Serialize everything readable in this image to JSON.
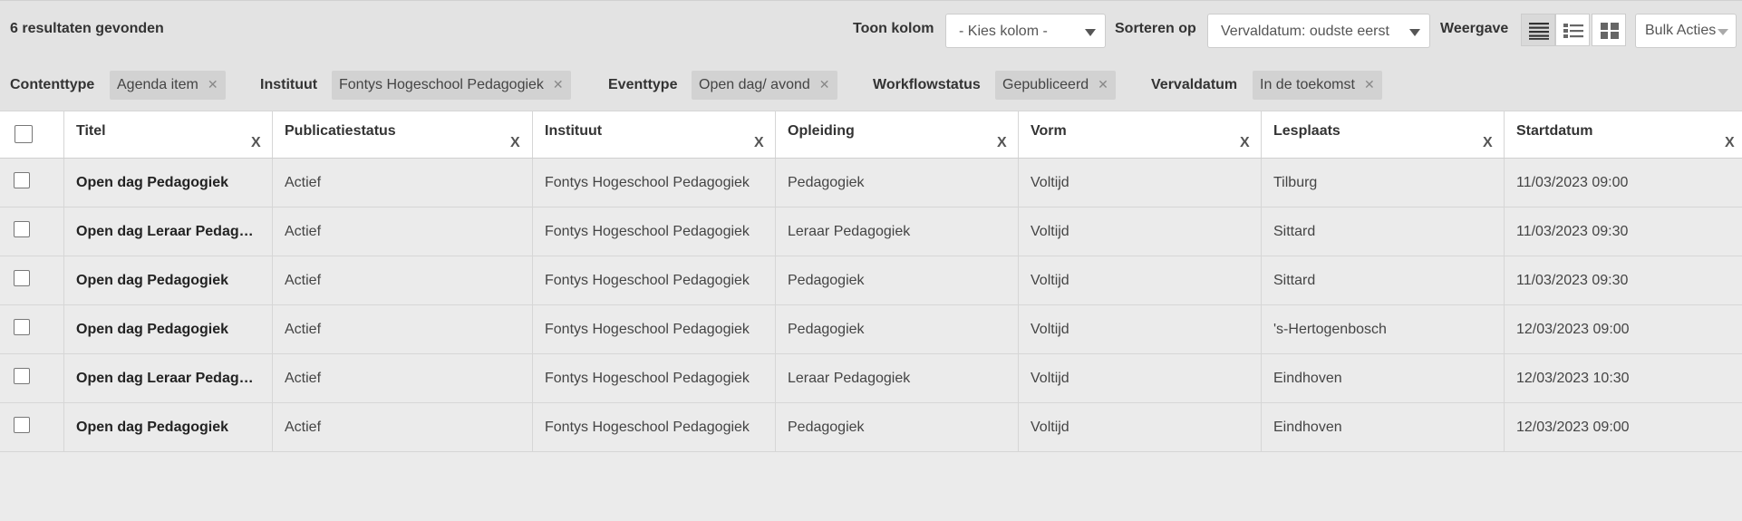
{
  "toolbar": {
    "results_count": "6 resultaten gevonden",
    "show_column_label": "Toon kolom",
    "show_column_value": "- Kies kolom -",
    "sort_label": "Sorteren op",
    "sort_value": "Vervaldatum: oudste eerst",
    "view_label": "Weergave",
    "views": [
      "table-view-icon",
      "list-view-icon",
      "grid-view-icon"
    ],
    "active_view": "table-view-icon",
    "bulk_label": "Bulk Acties"
  },
  "filters": [
    {
      "label": "Contenttype",
      "value": "Agenda item"
    },
    {
      "label": "Instituut",
      "value": "Fontys Hogeschool Pedagogiek"
    },
    {
      "label": "Eventtype",
      "value": "Open dag/ avond"
    },
    {
      "label": "Workflowstatus",
      "value": "Gepubliceerd"
    },
    {
      "label": "Vervaldatum",
      "value": "In de toekomst"
    }
  ],
  "table": {
    "columns": [
      "Titel",
      "Publicatiestatus",
      "Instituut",
      "Opleiding",
      "Vorm",
      "Lesplaats",
      "Startdatum"
    ],
    "remove_column_label": "X",
    "rows": [
      [
        "Open dag Pedagogiek",
        "Actief",
        "Fontys Hogeschool Pedagogiek",
        "Pedagogiek",
        "Voltijd",
        "Tilburg",
        "11/03/2023 09:00"
      ],
      [
        "Open dag Leraar Pedagogiek",
        "Actief",
        "Fontys Hogeschool Pedagogiek",
        "Leraar Pedagogiek",
        "Voltijd",
        "Sittard",
        "11/03/2023 09:30"
      ],
      [
        "Open dag Pedagogiek",
        "Actief",
        "Fontys Hogeschool Pedagogiek",
        "Pedagogiek",
        "Voltijd",
        "Sittard",
        "11/03/2023 09:30"
      ],
      [
        "Open dag Pedagogiek",
        "Actief",
        "Fontys Hogeschool Pedagogiek",
        "Pedagogiek",
        "Voltijd",
        "'s-Hertogenbosch",
        "12/03/2023 09:00"
      ],
      [
        "Open dag Leraar Pedagogiek",
        "Actief",
        "Fontys Hogeschool Pedagogiek",
        "Leraar Pedagogiek",
        "Voltijd",
        "Eindhoven",
        "12/03/2023 10:30"
      ],
      [
        "Open dag Pedagogiek",
        "Actief",
        "Fontys Hogeschool Pedagogiek",
        "Pedagogiek",
        "Voltijd",
        "Eindhoven",
        "12/03/2023 09:00"
      ]
    ]
  }
}
